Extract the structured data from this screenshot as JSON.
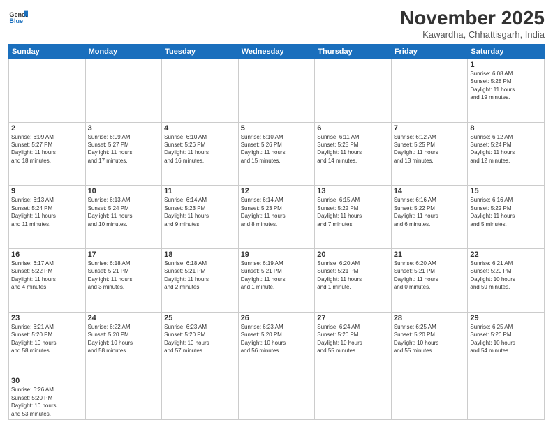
{
  "logo": {
    "text_general": "General",
    "text_blue": "Blue"
  },
  "header": {
    "month_title": "November 2025",
    "subtitle": "Kawardha, Chhattisgarh, India"
  },
  "weekdays": [
    "Sunday",
    "Monday",
    "Tuesday",
    "Wednesday",
    "Thursday",
    "Friday",
    "Saturday"
  ],
  "days": {
    "d1": {
      "num": "1",
      "info": "Sunrise: 6:08 AM\nSunset: 5:28 PM\nDaylight: 11 hours\nand 19 minutes."
    },
    "d2": {
      "num": "2",
      "info": "Sunrise: 6:09 AM\nSunset: 5:27 PM\nDaylight: 11 hours\nand 18 minutes."
    },
    "d3": {
      "num": "3",
      "info": "Sunrise: 6:09 AM\nSunset: 5:27 PM\nDaylight: 11 hours\nand 17 minutes."
    },
    "d4": {
      "num": "4",
      "info": "Sunrise: 6:10 AM\nSunset: 5:26 PM\nDaylight: 11 hours\nand 16 minutes."
    },
    "d5": {
      "num": "5",
      "info": "Sunrise: 6:10 AM\nSunset: 5:26 PM\nDaylight: 11 hours\nand 15 minutes."
    },
    "d6": {
      "num": "6",
      "info": "Sunrise: 6:11 AM\nSunset: 5:25 PM\nDaylight: 11 hours\nand 14 minutes."
    },
    "d7": {
      "num": "7",
      "info": "Sunrise: 6:12 AM\nSunset: 5:25 PM\nDaylight: 11 hours\nand 13 minutes."
    },
    "d8": {
      "num": "8",
      "info": "Sunrise: 6:12 AM\nSunset: 5:24 PM\nDaylight: 11 hours\nand 12 minutes."
    },
    "d9": {
      "num": "9",
      "info": "Sunrise: 6:13 AM\nSunset: 5:24 PM\nDaylight: 11 hours\nand 11 minutes."
    },
    "d10": {
      "num": "10",
      "info": "Sunrise: 6:13 AM\nSunset: 5:24 PM\nDaylight: 11 hours\nand 10 minutes."
    },
    "d11": {
      "num": "11",
      "info": "Sunrise: 6:14 AM\nSunset: 5:23 PM\nDaylight: 11 hours\nand 9 minutes."
    },
    "d12": {
      "num": "12",
      "info": "Sunrise: 6:14 AM\nSunset: 5:23 PM\nDaylight: 11 hours\nand 8 minutes."
    },
    "d13": {
      "num": "13",
      "info": "Sunrise: 6:15 AM\nSunset: 5:22 PM\nDaylight: 11 hours\nand 7 minutes."
    },
    "d14": {
      "num": "14",
      "info": "Sunrise: 6:16 AM\nSunset: 5:22 PM\nDaylight: 11 hours\nand 6 minutes."
    },
    "d15": {
      "num": "15",
      "info": "Sunrise: 6:16 AM\nSunset: 5:22 PM\nDaylight: 11 hours\nand 5 minutes."
    },
    "d16": {
      "num": "16",
      "info": "Sunrise: 6:17 AM\nSunset: 5:22 PM\nDaylight: 11 hours\nand 4 minutes."
    },
    "d17": {
      "num": "17",
      "info": "Sunrise: 6:18 AM\nSunset: 5:21 PM\nDaylight: 11 hours\nand 3 minutes."
    },
    "d18": {
      "num": "18",
      "info": "Sunrise: 6:18 AM\nSunset: 5:21 PM\nDaylight: 11 hours\nand 2 minutes."
    },
    "d19": {
      "num": "19",
      "info": "Sunrise: 6:19 AM\nSunset: 5:21 PM\nDaylight: 11 hours\nand 1 minute."
    },
    "d20": {
      "num": "20",
      "info": "Sunrise: 6:20 AM\nSunset: 5:21 PM\nDaylight: 11 hours\nand 1 minute."
    },
    "d21": {
      "num": "21",
      "info": "Sunrise: 6:20 AM\nSunset: 5:21 PM\nDaylight: 11 hours\nand 0 minutes."
    },
    "d22": {
      "num": "22",
      "info": "Sunrise: 6:21 AM\nSunset: 5:20 PM\nDaylight: 10 hours\nand 59 minutes."
    },
    "d23": {
      "num": "23",
      "info": "Sunrise: 6:21 AM\nSunset: 5:20 PM\nDaylight: 10 hours\nand 58 minutes."
    },
    "d24": {
      "num": "24",
      "info": "Sunrise: 6:22 AM\nSunset: 5:20 PM\nDaylight: 10 hours\nand 58 minutes."
    },
    "d25": {
      "num": "25",
      "info": "Sunrise: 6:23 AM\nSunset: 5:20 PM\nDaylight: 10 hours\nand 57 minutes."
    },
    "d26": {
      "num": "26",
      "info": "Sunrise: 6:23 AM\nSunset: 5:20 PM\nDaylight: 10 hours\nand 56 minutes."
    },
    "d27": {
      "num": "27",
      "info": "Sunrise: 6:24 AM\nSunset: 5:20 PM\nDaylight: 10 hours\nand 55 minutes."
    },
    "d28": {
      "num": "28",
      "info": "Sunrise: 6:25 AM\nSunset: 5:20 PM\nDaylight: 10 hours\nand 55 minutes."
    },
    "d29": {
      "num": "29",
      "info": "Sunrise: 6:25 AM\nSunset: 5:20 PM\nDaylight: 10 hours\nand 54 minutes."
    },
    "d30": {
      "num": "30",
      "info": "Sunrise: 6:26 AM\nSunset: 5:20 PM\nDaylight: 10 hours\nand 53 minutes."
    }
  }
}
